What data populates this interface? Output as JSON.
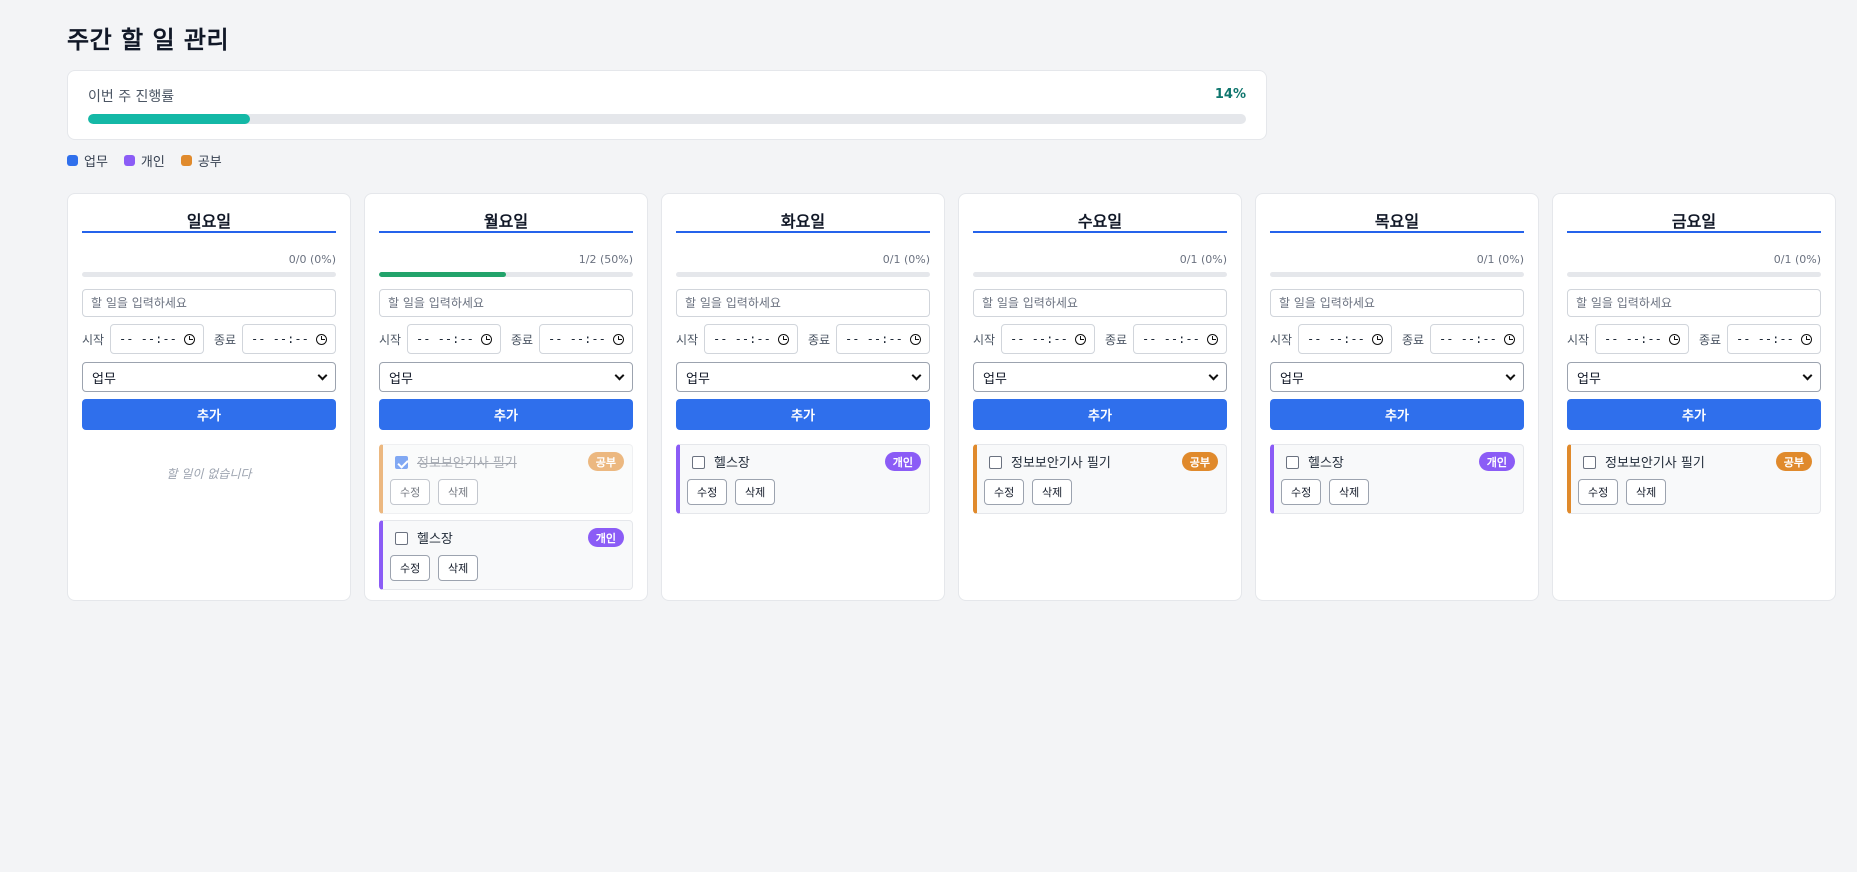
{
  "title": "주간 할 일 관리",
  "weekly_progress": {
    "label": "이번 주 진행률",
    "percent_text": "14%",
    "fraction": 0.14
  },
  "legend": [
    {
      "label": "업무",
      "color": "#2f6fec"
    },
    {
      "label": "개인",
      "color": "#8b5cf6"
    },
    {
      "label": "공부",
      "color": "#e08a2c"
    }
  ],
  "form": {
    "placeholder": "할 일을 입력하세요",
    "start_label": "시작",
    "end_label": "종료",
    "time_placeholder": "-- --:--",
    "category_selected": "업무",
    "add_label": "추가",
    "empty_text": "할 일이 없습니다",
    "edit_label": "수정",
    "delete_label": "삭제"
  },
  "days": [
    {
      "name": "일요일",
      "count_text": "0/0 (0%)",
      "fraction": 0,
      "tasks": []
    },
    {
      "name": "월요일",
      "count_text": "1/2 (50%)",
      "fraction": 0.5,
      "tasks": [
        {
          "text": "정보보안기사 필기",
          "category": "공부",
          "cat": "study",
          "done": true
        },
        {
          "text": "헬스장",
          "category": "개인",
          "cat": "personal",
          "done": false
        }
      ]
    },
    {
      "name": "화요일",
      "count_text": "0/1 (0%)",
      "fraction": 0,
      "tasks": [
        {
          "text": "헬스장",
          "category": "개인",
          "cat": "personal",
          "done": false
        }
      ]
    },
    {
      "name": "수요일",
      "count_text": "0/1 (0%)",
      "fraction": 0,
      "tasks": [
        {
          "text": "정보보안기사 필기",
          "category": "공부",
          "cat": "study",
          "done": false
        }
      ]
    },
    {
      "name": "목요일",
      "count_text": "0/1 (0%)",
      "fraction": 0,
      "tasks": [
        {
          "text": "헬스장",
          "category": "개인",
          "cat": "personal",
          "done": false
        }
      ]
    },
    {
      "name": "금요일",
      "count_text": "0/1 (0%)",
      "fraction": 0,
      "tasks": [
        {
          "text": "정보보안기사 필기",
          "category": "공부",
          "cat": "study",
          "done": false
        }
      ]
    }
  ]
}
